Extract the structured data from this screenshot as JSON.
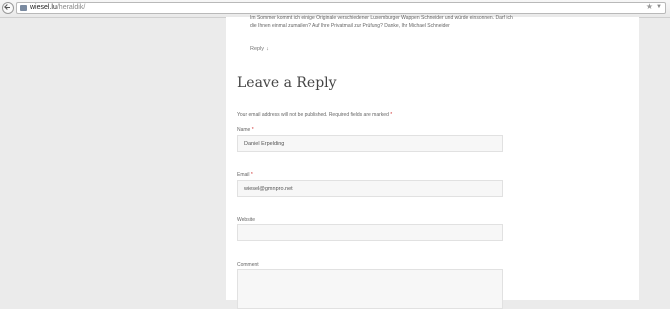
{
  "browser": {
    "url_host": "wiesel.lu",
    "url_path": "/heraldik/",
    "star_icon": "★",
    "dropdown_icon": "▼"
  },
  "comment": {
    "text": "Im Sommer kommt ich einige Originale verschiedener Luxemburger Wappen Schneider und würde einsonnen. Darf ich die Ihnen einmal zumailen? Auf Ihre Privatmail zur Prüfung? Danke, Ihr Michael Schneider",
    "reply_label": "Reply",
    "reply_arrow": "↓"
  },
  "form": {
    "title": "Leave a Reply",
    "notes_text": "Your email address will not be published. Required fields are marked ",
    "required_mark": "*",
    "name_label": "Name ",
    "name_value": "Daniel Erpelding",
    "email_label": "Email ",
    "email_value": "wiesel@gmnpro.net",
    "website_label": "Website",
    "website_value": "",
    "comment_label": "Comment"
  }
}
